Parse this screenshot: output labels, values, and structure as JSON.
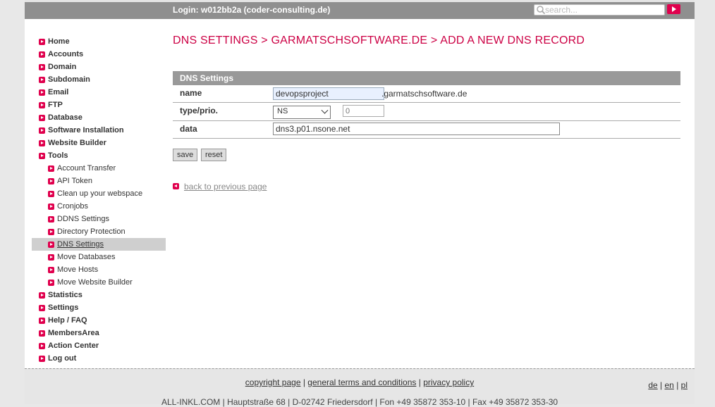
{
  "header": {
    "login_text": "Login: w012bb2a (coder-consulting.de)",
    "search_placeholder": "search..."
  },
  "sidebar": {
    "items": [
      {
        "label": "Home"
      },
      {
        "label": "Accounts"
      },
      {
        "label": "Domain"
      },
      {
        "label": "Subdomain"
      },
      {
        "label": "Email"
      },
      {
        "label": "FTP"
      },
      {
        "label": "Database"
      },
      {
        "label": "Software Installation"
      },
      {
        "label": "Website Builder"
      },
      {
        "label": "Tools"
      },
      {
        "label": "Account Transfer"
      },
      {
        "label": "API Token"
      },
      {
        "label": "Clean up your webspace"
      },
      {
        "label": "Cronjobs"
      },
      {
        "label": "DDNS Settings"
      },
      {
        "label": "Directory Protection"
      },
      {
        "label": "DNS Settings"
      },
      {
        "label": "Move Databases"
      },
      {
        "label": "Move Hosts"
      },
      {
        "label": "Move Website Builder"
      },
      {
        "label": "Statistics"
      },
      {
        "label": "Settings"
      },
      {
        "label": "Help / FAQ"
      },
      {
        "label": "MembersArea"
      },
      {
        "label": "Action Center"
      },
      {
        "label": "Log out"
      }
    ]
  },
  "main": {
    "title": "DNS SETTINGS > GARMATSCHSOFTWARE.DE > ADD A NEW DNS RECORD",
    "section_title": "DNS Settings",
    "form": {
      "name_label": "name",
      "name_value": "devopsproject",
      "name_suffix": ".garmatschsoftware.de",
      "type_label": "type/prio.",
      "type_value": "NS",
      "prio_placeholder": "0",
      "data_label": "data",
      "data_value": "dns3.p01.nsone.net"
    },
    "save_label": "save",
    "reset_label": "reset",
    "back_label": "back to previous page"
  },
  "footer": {
    "copyright": "copyright page",
    "terms": "general terms and conditions",
    "privacy": "privacy policy",
    "lang_de": "de",
    "lang_en": "en",
    "lang_pl": "pl",
    "address": "ALL-INKL.COM | Hauptstraße 68 | D-02742 Friedersdorf | Fon +49 35872 353-10 | Fax +49 35872 353-30"
  },
  "colors": {
    "accent": "#cc0044",
    "bullet": "#e0004d",
    "topbar": "#8f8f8f"
  }
}
